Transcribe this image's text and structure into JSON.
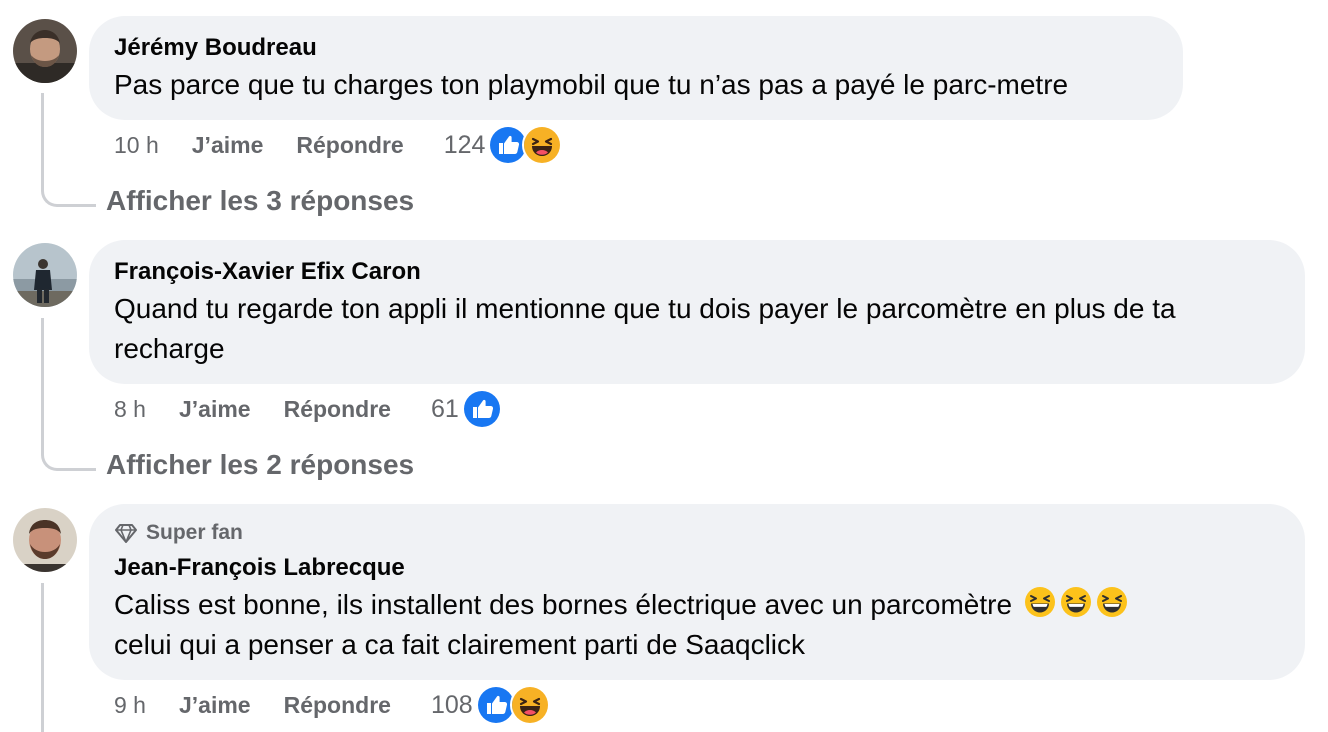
{
  "comments": [
    {
      "author": "Jérémy Boudreau",
      "text": "Pas parce que tu charges ton playmobil que tu n’as pas a payé le parc-metre",
      "time": "10 h",
      "like_label": "J’aime",
      "reply_label": "Répondre",
      "reaction_count": "124",
      "reactions": [
        "like-icon",
        "haha-icon"
      ],
      "replies_link": "Afficher les 3 réponses"
    },
    {
      "author": "François-Xavier Efix Caron",
      "text_line1": "Quand tu regarde ton appli il mentionne que tu dois payer le parcomètre en plus de ta",
      "text_line2": "recharge",
      "time": "8 h",
      "like_label": "J’aime",
      "reply_label": "Répondre",
      "reaction_count": "61",
      "reactions": [
        "like-icon"
      ],
      "replies_link": "Afficher les 2 réponses"
    },
    {
      "badge": "Super fan",
      "badge_icon": "diamond-icon",
      "author": "Jean-François Labrecque",
      "text_line1": "Caliss est bonne, ils installent des bornes électrique avec un parcomètre",
      "text_line1_emojis": [
        "laughing-emoji",
        "laughing-emoji",
        "laughing-emoji"
      ],
      "text_line2": "celui qui a penser a ca fait clairement parti de Saaqclick",
      "time": "9 h",
      "like_label": "J’aime",
      "reply_label": "Répondre",
      "reaction_count": "108",
      "reactions": [
        "like-icon",
        "haha-icon"
      ]
    }
  ],
  "colors": {
    "bubble": "#f0f2f5",
    "secondary_text": "#65676b",
    "like_blue": "#1877f2",
    "haha_yellow": "#f7b125"
  }
}
